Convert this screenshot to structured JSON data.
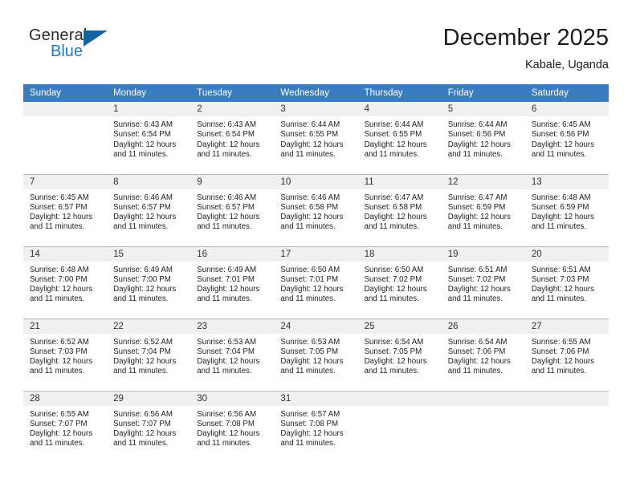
{
  "brand": {
    "name_part1": "General",
    "name_part2": "Blue",
    "triangle_color": "#15659e",
    "blue_color": "#2079c6"
  },
  "header": {
    "title": "December 2025",
    "subtitle": "Kabale, Uganda",
    "header_bg_color": "#3a7cc0",
    "daynum_bg_color": "#f0f0f0"
  },
  "weekday_headers": [
    "Sunday",
    "Monday",
    "Tuesday",
    "Wednesday",
    "Thursday",
    "Friday",
    "Saturday"
  ],
  "labels": {
    "sunrise_prefix": "Sunrise:",
    "sunset_prefix": "Sunset:",
    "daylight_prefix": "Daylight:"
  },
  "weeks": [
    [
      {
        "day": "",
        "sunrise": "",
        "sunset": "",
        "daylight_line1": "",
        "daylight_line2": ""
      },
      {
        "day": "1",
        "sunrise": "Sunrise: 6:43 AM",
        "sunset": "Sunset: 6:54 PM",
        "daylight_line1": "Daylight: 12 hours",
        "daylight_line2": "and 11 minutes."
      },
      {
        "day": "2",
        "sunrise": "Sunrise: 6:43 AM",
        "sunset": "Sunset: 6:54 PM",
        "daylight_line1": "Daylight: 12 hours",
        "daylight_line2": "and 11 minutes."
      },
      {
        "day": "3",
        "sunrise": "Sunrise: 6:44 AM",
        "sunset": "Sunset: 6:55 PM",
        "daylight_line1": "Daylight: 12 hours",
        "daylight_line2": "and 11 minutes."
      },
      {
        "day": "4",
        "sunrise": "Sunrise: 6:44 AM",
        "sunset": "Sunset: 6:55 PM",
        "daylight_line1": "Daylight: 12 hours",
        "daylight_line2": "and 11 minutes."
      },
      {
        "day": "5",
        "sunrise": "Sunrise: 6:44 AM",
        "sunset": "Sunset: 6:56 PM",
        "daylight_line1": "Daylight: 12 hours",
        "daylight_line2": "and 11 minutes."
      },
      {
        "day": "6",
        "sunrise": "Sunrise: 6:45 AM",
        "sunset": "Sunset: 6:56 PM",
        "daylight_line1": "Daylight: 12 hours",
        "daylight_line2": "and 11 minutes."
      }
    ],
    [
      {
        "day": "7",
        "sunrise": "Sunrise: 6:45 AM",
        "sunset": "Sunset: 6:57 PM",
        "daylight_line1": "Daylight: 12 hours",
        "daylight_line2": "and 11 minutes."
      },
      {
        "day": "8",
        "sunrise": "Sunrise: 6:46 AM",
        "sunset": "Sunset: 6:57 PM",
        "daylight_line1": "Daylight: 12 hours",
        "daylight_line2": "and 11 minutes."
      },
      {
        "day": "9",
        "sunrise": "Sunrise: 6:46 AM",
        "sunset": "Sunset: 6:57 PM",
        "daylight_line1": "Daylight: 12 hours",
        "daylight_line2": "and 11 minutes."
      },
      {
        "day": "10",
        "sunrise": "Sunrise: 6:46 AM",
        "sunset": "Sunset: 6:58 PM",
        "daylight_line1": "Daylight: 12 hours",
        "daylight_line2": "and 11 minutes."
      },
      {
        "day": "11",
        "sunrise": "Sunrise: 6:47 AM",
        "sunset": "Sunset: 6:58 PM",
        "daylight_line1": "Daylight: 12 hours",
        "daylight_line2": "and 11 minutes."
      },
      {
        "day": "12",
        "sunrise": "Sunrise: 6:47 AM",
        "sunset": "Sunset: 6:59 PM",
        "daylight_line1": "Daylight: 12 hours",
        "daylight_line2": "and 11 minutes."
      },
      {
        "day": "13",
        "sunrise": "Sunrise: 6:48 AM",
        "sunset": "Sunset: 6:59 PM",
        "daylight_line1": "Daylight: 12 hours",
        "daylight_line2": "and 11 minutes."
      }
    ],
    [
      {
        "day": "14",
        "sunrise": "Sunrise: 6:48 AM",
        "sunset": "Sunset: 7:00 PM",
        "daylight_line1": "Daylight: 12 hours",
        "daylight_line2": "and 11 minutes."
      },
      {
        "day": "15",
        "sunrise": "Sunrise: 6:49 AM",
        "sunset": "Sunset: 7:00 PM",
        "daylight_line1": "Daylight: 12 hours",
        "daylight_line2": "and 11 minutes."
      },
      {
        "day": "16",
        "sunrise": "Sunrise: 6:49 AM",
        "sunset": "Sunset: 7:01 PM",
        "daylight_line1": "Daylight: 12 hours",
        "daylight_line2": "and 11 minutes."
      },
      {
        "day": "17",
        "sunrise": "Sunrise: 6:50 AM",
        "sunset": "Sunset: 7:01 PM",
        "daylight_line1": "Daylight: 12 hours",
        "daylight_line2": "and 11 minutes."
      },
      {
        "day": "18",
        "sunrise": "Sunrise: 6:50 AM",
        "sunset": "Sunset: 7:02 PM",
        "daylight_line1": "Daylight: 12 hours",
        "daylight_line2": "and 11 minutes."
      },
      {
        "day": "19",
        "sunrise": "Sunrise: 6:51 AM",
        "sunset": "Sunset: 7:02 PM",
        "daylight_line1": "Daylight: 12 hours",
        "daylight_line2": "and 11 minutes."
      },
      {
        "day": "20",
        "sunrise": "Sunrise: 6:51 AM",
        "sunset": "Sunset: 7:03 PM",
        "daylight_line1": "Daylight: 12 hours",
        "daylight_line2": "and 11 minutes."
      }
    ],
    [
      {
        "day": "21",
        "sunrise": "Sunrise: 6:52 AM",
        "sunset": "Sunset: 7:03 PM",
        "daylight_line1": "Daylight: 12 hours",
        "daylight_line2": "and 11 minutes."
      },
      {
        "day": "22",
        "sunrise": "Sunrise: 6:52 AM",
        "sunset": "Sunset: 7:04 PM",
        "daylight_line1": "Daylight: 12 hours",
        "daylight_line2": "and 11 minutes."
      },
      {
        "day": "23",
        "sunrise": "Sunrise: 6:53 AM",
        "sunset": "Sunset: 7:04 PM",
        "daylight_line1": "Daylight: 12 hours",
        "daylight_line2": "and 11 minutes."
      },
      {
        "day": "24",
        "sunrise": "Sunrise: 6:53 AM",
        "sunset": "Sunset: 7:05 PM",
        "daylight_line1": "Daylight: 12 hours",
        "daylight_line2": "and 11 minutes."
      },
      {
        "day": "25",
        "sunrise": "Sunrise: 6:54 AM",
        "sunset": "Sunset: 7:05 PM",
        "daylight_line1": "Daylight: 12 hours",
        "daylight_line2": "and 11 minutes."
      },
      {
        "day": "26",
        "sunrise": "Sunrise: 6:54 AM",
        "sunset": "Sunset: 7:06 PM",
        "daylight_line1": "Daylight: 12 hours",
        "daylight_line2": "and 11 minutes."
      },
      {
        "day": "27",
        "sunrise": "Sunrise: 6:55 AM",
        "sunset": "Sunset: 7:06 PM",
        "daylight_line1": "Daylight: 12 hours",
        "daylight_line2": "and 11 minutes."
      }
    ],
    [
      {
        "day": "28",
        "sunrise": "Sunrise: 6:55 AM",
        "sunset": "Sunset: 7:07 PM",
        "daylight_line1": "Daylight: 12 hours",
        "daylight_line2": "and 11 minutes."
      },
      {
        "day": "29",
        "sunrise": "Sunrise: 6:56 AM",
        "sunset": "Sunset: 7:07 PM",
        "daylight_line1": "Daylight: 12 hours",
        "daylight_line2": "and 11 minutes."
      },
      {
        "day": "30",
        "sunrise": "Sunrise: 6:56 AM",
        "sunset": "Sunset: 7:08 PM",
        "daylight_line1": "Daylight: 12 hours",
        "daylight_line2": "and 11 minutes."
      },
      {
        "day": "31",
        "sunrise": "Sunrise: 6:57 AM",
        "sunset": "Sunset: 7:08 PM",
        "daylight_line1": "Daylight: 12 hours",
        "daylight_line2": "and 11 minutes."
      },
      {
        "day": "",
        "sunrise": "",
        "sunset": "",
        "daylight_line1": "",
        "daylight_line2": ""
      },
      {
        "day": "",
        "sunrise": "",
        "sunset": "",
        "daylight_line1": "",
        "daylight_line2": ""
      },
      {
        "day": "",
        "sunrise": "",
        "sunset": "",
        "daylight_line1": "",
        "daylight_line2": ""
      }
    ]
  ]
}
